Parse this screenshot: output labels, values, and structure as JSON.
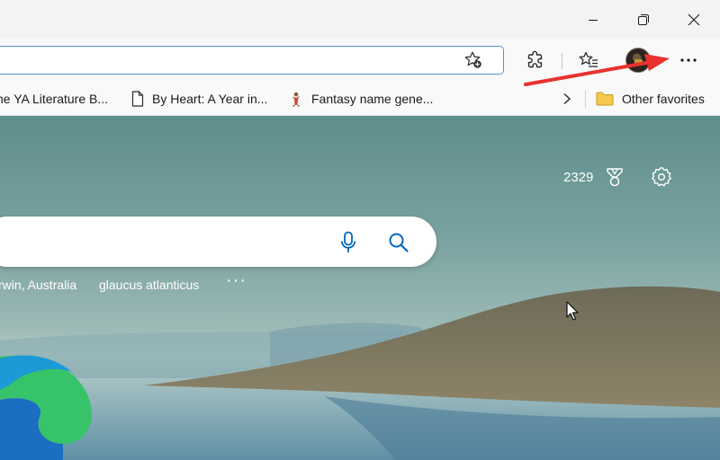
{
  "window_controls": {
    "minimize_icon": "minimize-icon",
    "restore_icon": "restore-icon",
    "close_icon": "close-icon"
  },
  "toolbar": {
    "address_value": "",
    "icons": [
      "add-favorite-icon",
      "extensions-icon",
      "favorites-icon",
      "profile-avatar",
      "more-options-icon"
    ]
  },
  "favorites_bar": {
    "items": [
      {
        "label": "he YA Literature B...",
        "icon": "none"
      },
      {
        "label": "By Heart: A Year in...",
        "icon": "document-icon"
      },
      {
        "label": "Fantasy name gene...",
        "icon": "site-icon"
      }
    ],
    "overflow_icon": "chevron-right-icon",
    "other_favorites": {
      "label": "Other favorites",
      "icon": "folder-icon"
    }
  },
  "new_tab": {
    "rewards_points": "2329",
    "search_box": {
      "value": "",
      "icons": [
        "microphone-icon",
        "search-icon"
      ]
    },
    "trending": [
      "rwin, Australia",
      "glaucus atlanticus"
    ],
    "more_label": "···"
  },
  "annotation": {
    "arrow_color": "#e8322f"
  },
  "colors": {
    "accent": "#0067c0",
    "address_border": "#5a8fd6"
  }
}
